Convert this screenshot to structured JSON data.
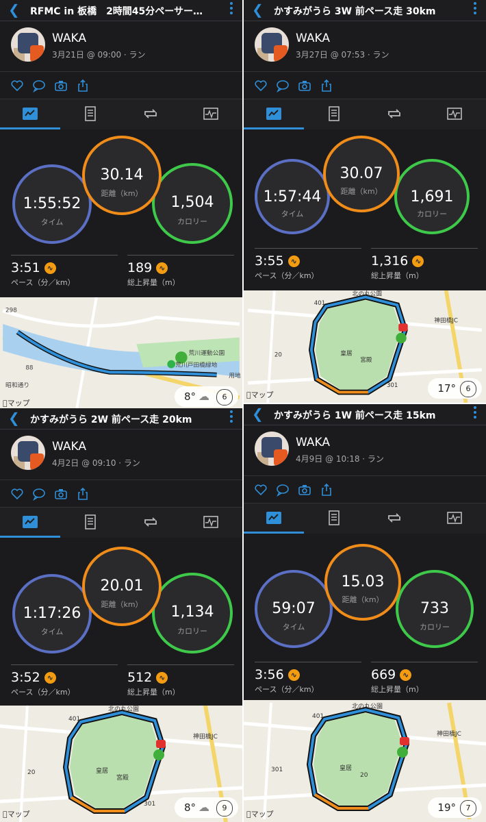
{
  "panels": [
    {
      "title": "RFMC in 板橋　2時間45分ペーサー…",
      "user": "WAKA",
      "date": "3月21日 @ 09:00 · ラン",
      "time": "1:55:52",
      "time_label": "タイム",
      "distance": "30.14",
      "distance_label": "距離（km）",
      "calories": "1,504",
      "calories_label": "カロリー",
      "pace": "3:51",
      "pace_label": "ペース（分／km）",
      "ascent": "189",
      "ascent_label": "総上昇量（m）",
      "map_labels": [
        "298",
        "88",
        "荒川運動公園",
        "荒川戸田橋緑地",
        "昭和通り",
        "用地"
      ],
      "map_brand": "マップ",
      "weather_temp": "8°",
      "wind": "6"
    },
    {
      "title": "かすみがうら 3W 前ペース走 30km",
      "user": "WAKA",
      "date": "3月27日 @ 07:53 · ラン",
      "time": "1:57:44",
      "time_label": "タイム",
      "distance": "30.07",
      "distance_label": "距離（km）",
      "calories": "1,691",
      "calories_label": "カロリー",
      "pace": "3:55",
      "pace_label": "ペース（分／km）",
      "ascent": "1,316",
      "ascent_label": "総上昇量（m）",
      "map_labels": [
        "401",
        "北の丸公園",
        "神田橋JC",
        "皇居",
        "宮殿",
        "20",
        "301"
      ],
      "map_brand": "マップ",
      "weather_temp": "17°",
      "wind": "6"
    },
    {
      "title": "かすみがうら 2W 前ペース走 20km",
      "user": "WAKA",
      "date": "4月2日 @ 09:10 · ラン",
      "time": "1:17:26",
      "time_label": "タイム",
      "distance": "20.01",
      "distance_label": "距離（km）",
      "calories": "1,134",
      "calories_label": "カロリー",
      "pace": "3:52",
      "pace_label": "ペース（分／km）",
      "ascent": "512",
      "ascent_label": "総上昇量（m）",
      "map_labels": [
        "401",
        "北の丸公園",
        "神田橋JC",
        "皇居",
        "宮殿",
        "20",
        "301"
      ],
      "map_brand": "マップ",
      "weather_temp": "8°",
      "wind": "9"
    },
    {
      "title": "かすみがうら 1W 前ペース走 15km",
      "user": "WAKA",
      "date": "4月9日 @ 10:18 · ラン",
      "time": "59:07",
      "time_label": "タイム",
      "distance": "15.03",
      "distance_label": "距離（km）",
      "calories": "733",
      "calories_label": "カロリー",
      "pace": "3:56",
      "pace_label": "ペース（分／km）",
      "ascent": "669",
      "ascent_label": "総上昇量（m）",
      "map_labels": [
        "401",
        "北の丸公園",
        "神田橋JC",
        "皇居",
        "20",
        "301"
      ],
      "map_brand": "マップ",
      "weather_temp": "19°",
      "wind": "7"
    }
  ],
  "colors": {
    "accent": "#2f8fd8",
    "time_ring": "#5b6fc4",
    "distance_ring": "#f08c1a",
    "calories_ring": "#3fc94a",
    "background": "#1b1b1d"
  },
  "icons": {
    "back": "chevron-left-icon",
    "menu": "more-vertical-icon",
    "like": "heart-icon",
    "comment": "comment-icon",
    "photo": "camera-icon",
    "share": "share-icon",
    "stats_tab": "stats-icon",
    "details_tab": "document-icon",
    "laps_tab": "laps-icon",
    "chart_tab": "chart-icon",
    "metric": "wave-icon",
    "weather": "cloud-icon"
  }
}
